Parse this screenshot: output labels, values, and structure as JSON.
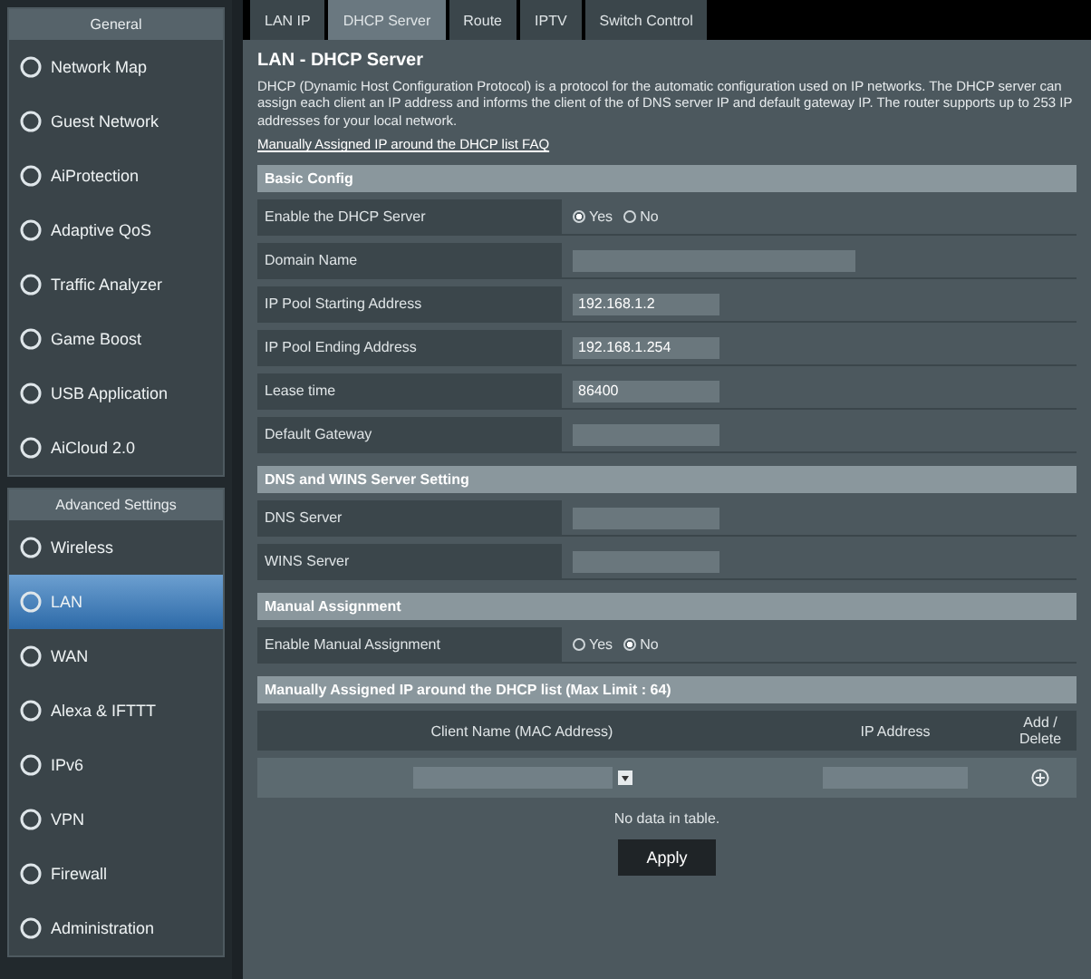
{
  "sidebar": {
    "sections": [
      {
        "title": "General",
        "items": [
          {
            "label": "Network Map",
            "selected": false
          },
          {
            "label": "Guest Network",
            "selected": false
          },
          {
            "label": "AiProtection",
            "selected": false
          },
          {
            "label": "Adaptive QoS",
            "selected": false
          },
          {
            "label": "Traffic Analyzer",
            "selected": false
          },
          {
            "label": "Game Boost",
            "selected": false
          },
          {
            "label": "USB Application",
            "selected": false
          },
          {
            "label": "AiCloud 2.0",
            "selected": false
          }
        ]
      },
      {
        "title": "Advanced Settings",
        "items": [
          {
            "label": "Wireless",
            "selected": false
          },
          {
            "label": "LAN",
            "selected": true
          },
          {
            "label": "WAN",
            "selected": false
          },
          {
            "label": "Alexa & IFTTT",
            "selected": false
          },
          {
            "label": "IPv6",
            "selected": false
          },
          {
            "label": "VPN",
            "selected": false
          },
          {
            "label": "Firewall",
            "selected": false
          },
          {
            "label": "Administration",
            "selected": false
          }
        ]
      }
    ]
  },
  "tabs": [
    {
      "label": "LAN IP",
      "selected": false
    },
    {
      "label": "DHCP Server",
      "selected": true
    },
    {
      "label": "Route",
      "selected": false
    },
    {
      "label": "IPTV",
      "selected": false
    },
    {
      "label": "Switch Control",
      "selected": false
    }
  ],
  "page": {
    "title": "LAN - DHCP Server",
    "description": "DHCP (Dynamic Host Configuration Protocol) is a protocol for the automatic configuration used on IP networks. The DHCP server can assign each client an IP address and informs the client of the of DNS server IP and default gateway IP. The router supports up to 253 IP addresses for your local network.",
    "link": "Manually Assigned IP around the DHCP list FAQ"
  },
  "sections": [
    {
      "title": "Basic Config",
      "rows": [
        {
          "kind": "radio",
          "label": "Enable the DHCP Server",
          "options": [
            {
              "label": "Yes",
              "selected": true
            },
            {
              "label": "No",
              "selected": false
            }
          ]
        },
        {
          "kind": "field",
          "label": "Domain Name",
          "value": "",
          "wide": true
        },
        {
          "kind": "field",
          "label": "IP Pool Starting Address",
          "value": "192.168.1.2"
        },
        {
          "kind": "field",
          "label": "IP Pool Ending Address",
          "value": "192.168.1.254"
        },
        {
          "kind": "field",
          "label": "Lease time",
          "value": "86400"
        },
        {
          "kind": "field",
          "label": "Default Gateway",
          "value": ""
        }
      ]
    },
    {
      "title": "DNS and WINS Server Setting",
      "rows": [
        {
          "kind": "field",
          "label": "DNS Server",
          "value": ""
        },
        {
          "kind": "field",
          "label": "WINS Server",
          "value": ""
        }
      ]
    },
    {
      "title": "Manual Assignment",
      "rows": [
        {
          "kind": "radio",
          "label": "Enable Manual Assignment",
          "options": [
            {
              "label": "Yes",
              "selected": false
            },
            {
              "label": "No",
              "selected": true
            }
          ]
        }
      ]
    }
  ],
  "table": {
    "title": "Manually Assigned IP around the DHCP list (Max Limit : 64)",
    "columns": [
      "Client Name (MAC Address)",
      "IP Address",
      "Add / Delete"
    ]
  },
  "empty_note": "No data in table.",
  "apply": "Apply"
}
